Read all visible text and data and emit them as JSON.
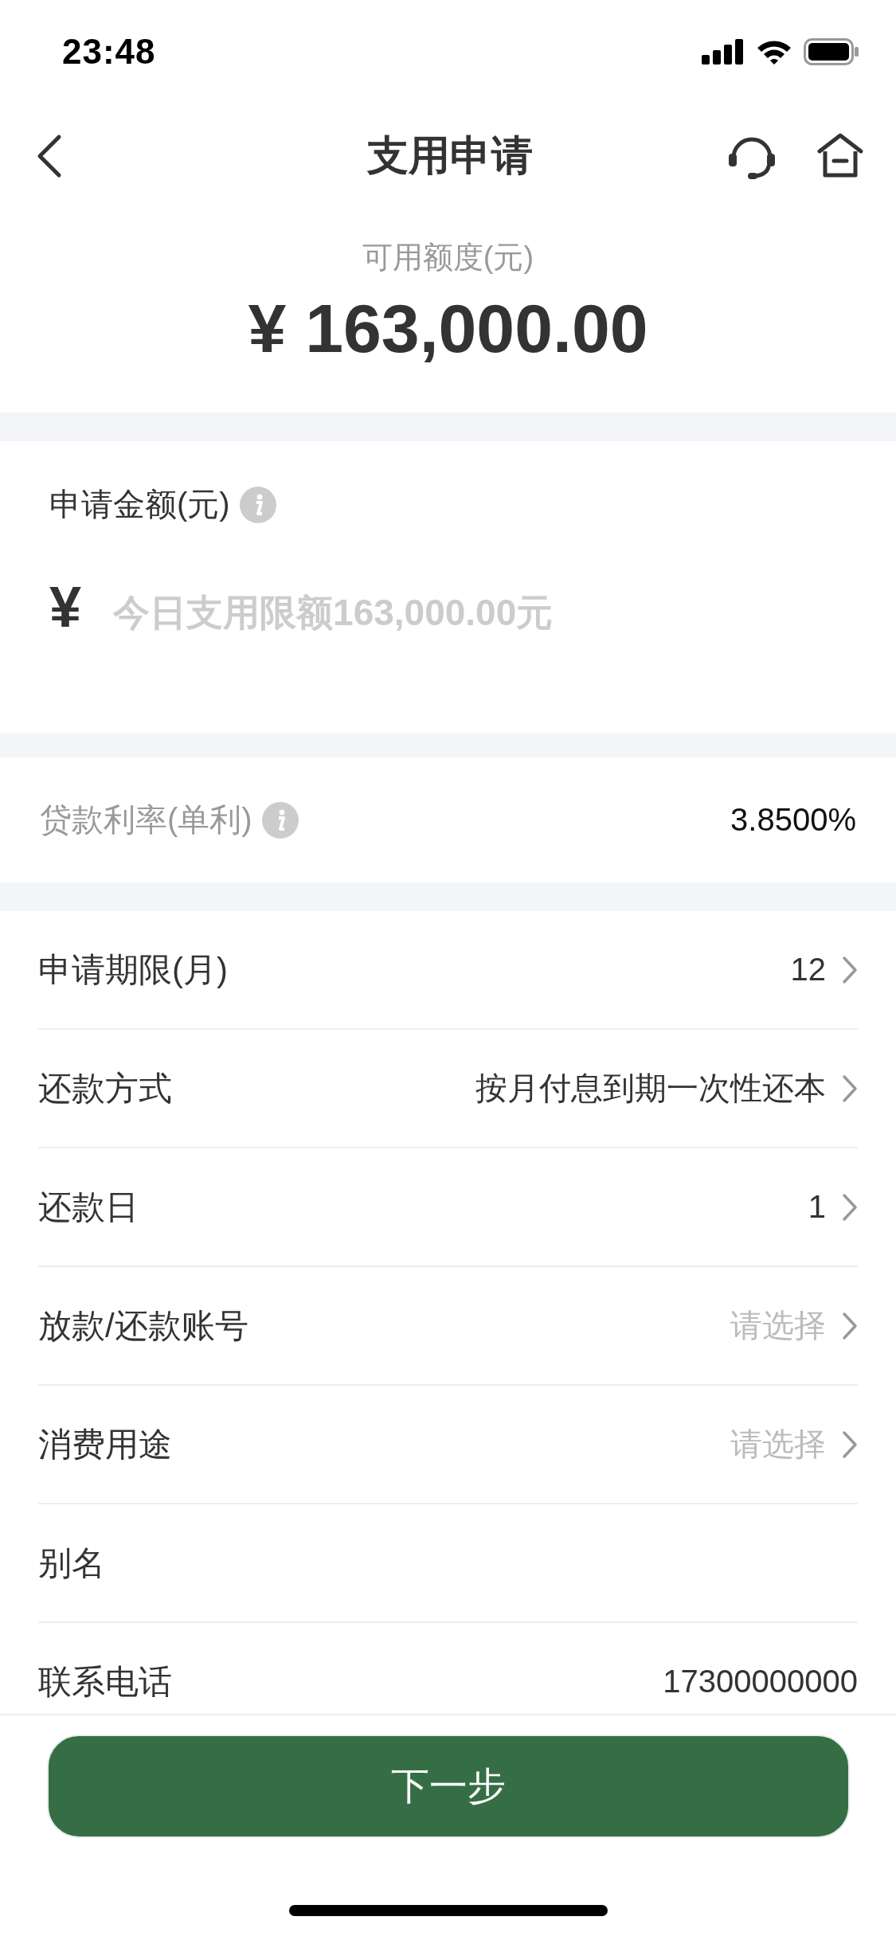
{
  "status_bar": {
    "time": "23:48"
  },
  "nav": {
    "title": "支用申请"
  },
  "credit": {
    "label": "可用额度(元)",
    "amount": "¥ 163,000.00"
  },
  "apply_amount": {
    "label": "申请金额(元)",
    "currency": "¥",
    "placeholder": "今日支用限额163,000.00元"
  },
  "rate": {
    "label": "贷款利率(单利)",
    "value": "3.8500%"
  },
  "rows": [
    {
      "label": "申请期限(月)",
      "value": "12",
      "chevron": true
    },
    {
      "label": "还款方式",
      "value": "按月付息到期一次性还本",
      "chevron": true
    },
    {
      "label": "还款日",
      "value": "1",
      "chevron": true
    },
    {
      "label": "放款/还款账号",
      "placeholder": "请选择",
      "chevron": true
    },
    {
      "label": "消费用途",
      "placeholder": "请选择",
      "chevron": true
    },
    {
      "label": "别名",
      "chevron": false
    },
    {
      "label": "联系电话",
      "value": "17300000000",
      "chevron": false
    }
  ],
  "next_button": "下一步"
}
